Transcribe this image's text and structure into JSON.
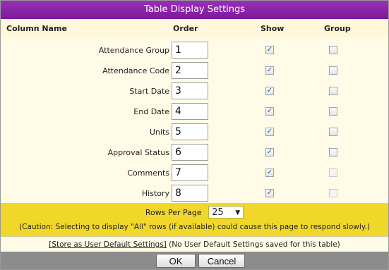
{
  "dialog": {
    "title": "Table Display Settings",
    "headers": {
      "column_name": "Column Name",
      "order": "Order",
      "show": "Show",
      "group": "Group"
    },
    "rows": [
      {
        "label": "Attendance Group",
        "order": "1",
        "show": true,
        "group": false,
        "group_enabled": true
      },
      {
        "label": "Attendance Code",
        "order": "2",
        "show": true,
        "group": false,
        "group_enabled": true
      },
      {
        "label": "Start Date",
        "order": "3",
        "show": true,
        "group": false,
        "group_enabled": true
      },
      {
        "label": "End Date",
        "order": "4",
        "show": true,
        "group": false,
        "group_enabled": true
      },
      {
        "label": "Units",
        "order": "5",
        "show": true,
        "group": false,
        "group_enabled": true
      },
      {
        "label": "Approval Status",
        "order": "6",
        "show": true,
        "group": false,
        "group_enabled": true
      },
      {
        "label": "Comments",
        "order": "7",
        "show": true,
        "group": false,
        "group_enabled": false
      },
      {
        "label": "History",
        "order": "8",
        "show": true,
        "group": false,
        "group_enabled": false
      }
    ],
    "rows_per_page": {
      "label": "Rows Per Page",
      "value": "25"
    },
    "caution": "(Caution: Selecting to display \"All\" rows (if available) could cause this page to respond slowly.)",
    "store_link": "[Store as User Default Settings]",
    "store_note": "(No User Default Settings saved for this table)",
    "buttons": {
      "ok": "OK",
      "cancel": "Cancel"
    },
    "colors": {
      "title_bar": "#8a24a8",
      "rows_per_page_bar": "#f1d72a",
      "footer": "#8c8c8c"
    },
    "icons": {
      "checked": "check-icon",
      "dropdown": "chevron-down-icon"
    }
  }
}
